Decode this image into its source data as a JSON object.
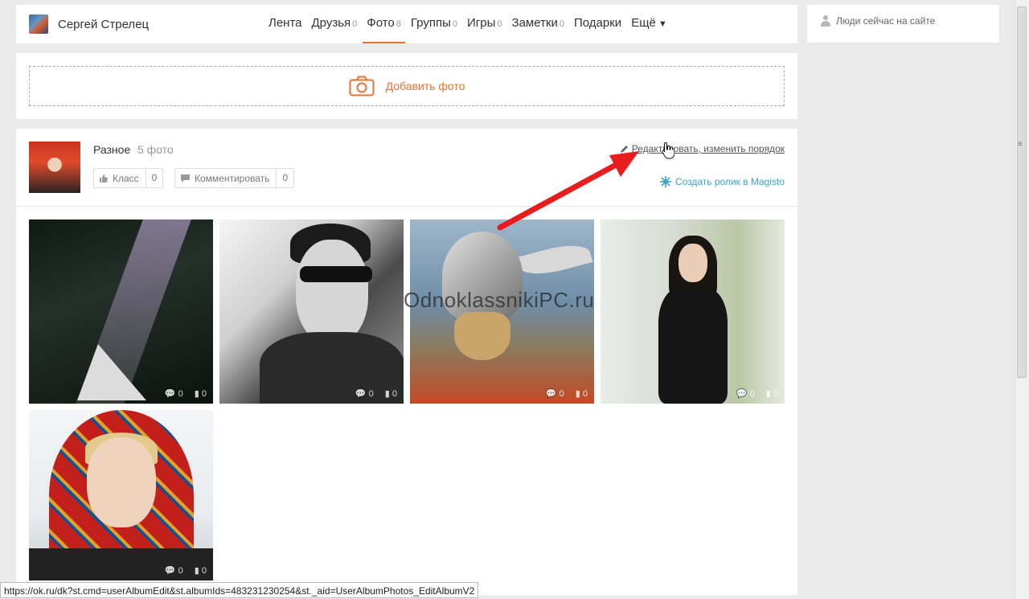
{
  "header": {
    "user_name": "Сергей Стрелец",
    "nav": [
      {
        "label": "Лента",
        "count": ""
      },
      {
        "label": "Друзья",
        "count": "0"
      },
      {
        "label": "Фото",
        "count": "8",
        "active": true
      },
      {
        "label": "Группы",
        "count": "0"
      },
      {
        "label": "Игры",
        "count": "0"
      },
      {
        "label": "Заметки",
        "count": "0"
      },
      {
        "label": "Подарки",
        "count": ""
      },
      {
        "label": "Ещё",
        "count": "",
        "icon": "triangle-down-icon"
      }
    ]
  },
  "sidebar": {
    "online_label": "Люди сейчас на сайте"
  },
  "add_photo": {
    "label": "Добавить фото"
  },
  "album": {
    "title": "Разное",
    "count_text": "5 фото",
    "klass_label": "Класс",
    "klass_count": "0",
    "comment_label": "Комментировать",
    "comment_count": "0",
    "edit_label": "Редактировать, изменить порядок",
    "magisto_label": "Создать ролик в Magisto",
    "photos": [
      {
        "comments": "0",
        "likes": "0"
      },
      {
        "comments": "0",
        "likes": "0"
      },
      {
        "comments": "0",
        "likes": "0"
      },
      {
        "comments": "0",
        "likes": "0"
      },
      {
        "comments": "0",
        "likes": "0"
      }
    ]
  },
  "watermark": "OdnoklassnikiPC.ru",
  "status_bar": "https://ok.ru/dk?st.cmd=userAlbumEdit&st.albumIds=483231230254&st._aid=UserAlbumPhotos_EditAlbumV2",
  "colors": {
    "accent": "#eb722e",
    "magisto": "#3aa7c6",
    "annotation_arrow": "#e81c1c"
  }
}
